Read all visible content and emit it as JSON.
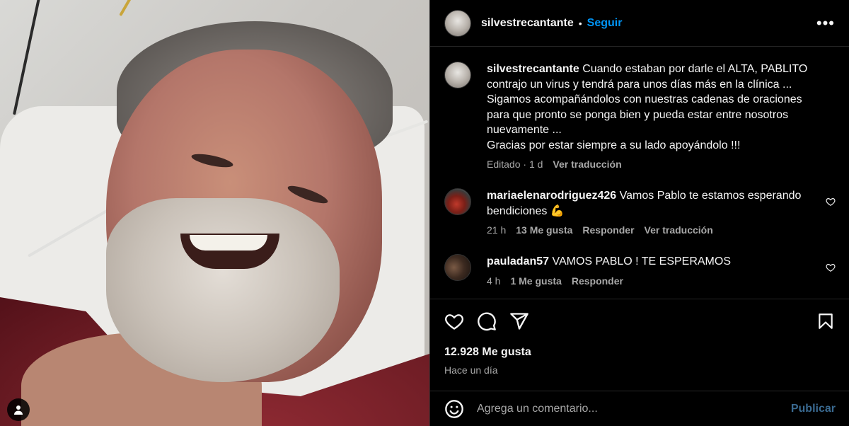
{
  "post": {
    "username": "silvestrecantante",
    "separator": "•",
    "follow_label": "Seguir",
    "more_label": "•••",
    "caption": {
      "username": "silvestrecantante",
      "text": "Cuando estaban por darle el ALTA, PABLITO contrajo un virus y tendrá para unos días más en la clínica ... Sigamos acompañándolos con nuestras cadenas de oraciones para que pronto se ponga bien y pueda estar entre nosotros nuevamente ... Gracias por estar siempre a su lado apoyándolo !!!",
      "lines": [
        "Cuando estaban por darle el ALTA, PABLITO",
        "contrajo un virus y tendrá para unos días más en la clínica ...",
        "Sigamos acompañándolos con nuestras cadenas de oraciones",
        "para que pronto se ponga bien y pueda estar entre nosotros",
        "nuevamente ...",
        "Gracias por estar siempre a su lado apoyándolo !!!"
      ],
      "edited": "Editado",
      "time": "1 d",
      "translate": "Ver traducción"
    },
    "comments": [
      {
        "username": "mariaelenarodriguez426",
        "text": "Vamos Pablo te estamos esperando bendiciones 💪",
        "time": "21 h",
        "likes": "13 Me gusta",
        "reply": "Responder",
        "translate": "Ver traducción"
      },
      {
        "username": "pauladan57",
        "text": "VAMOS PABLO ! TE ESPERAMOS",
        "time": "4 h",
        "likes": "1 Me gusta",
        "reply": "Responder"
      }
    ],
    "likes_count": "12.928 Me gusta",
    "posted_ago": "Hace un día",
    "comment_placeholder": "Agrega un comentario...",
    "publish_label": "Publicar"
  },
  "colors": {
    "background": "#000000",
    "link_blue": "#0095f6",
    "muted": "#a8a8a8",
    "publish_disabled": "#3a6a91"
  },
  "icons": [
    "user-tag-icon",
    "more-options-icon",
    "heart-icon",
    "comment-icon",
    "share-icon",
    "bookmark-icon",
    "emoji-icon",
    "small-heart-icon"
  ]
}
